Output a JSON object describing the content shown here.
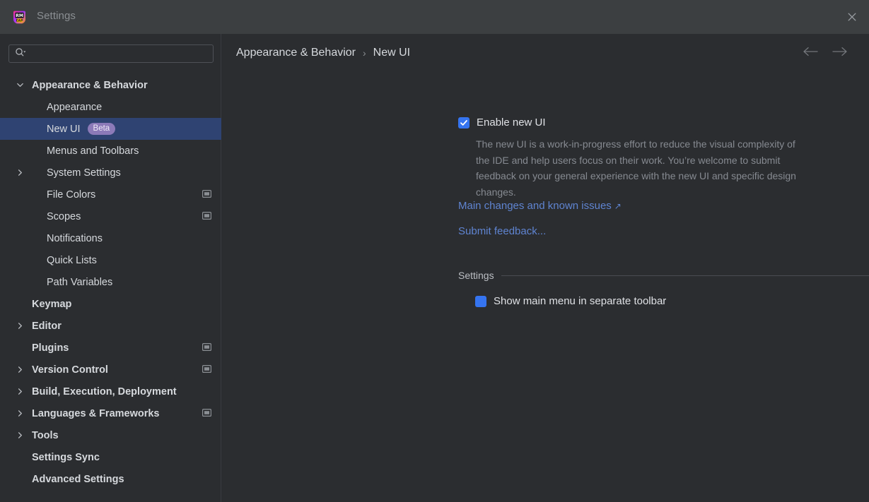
{
  "window": {
    "title": "Settings",
    "app_icon": "rubymine-eap-icon",
    "close_label": "×"
  },
  "sidebar": {
    "search": {
      "placeholder": "",
      "value": "",
      "icon": "search-icon"
    },
    "items": [
      {
        "label": "Appearance & Behavior",
        "level": 0,
        "expander": "chevron-down-icon",
        "selected": false,
        "scope_icon": false
      },
      {
        "label": "Appearance",
        "level": 1,
        "expander": "",
        "selected": false,
        "scope_icon": false
      },
      {
        "label": "New UI",
        "level": 1,
        "expander": "",
        "selected": true,
        "scope_icon": false,
        "badge": "Beta"
      },
      {
        "label": "Menus and Toolbars",
        "level": 1,
        "expander": "",
        "selected": false,
        "scope_icon": false
      },
      {
        "label": "System Settings",
        "level": 1,
        "expander": "chevron-right-icon",
        "selected": false,
        "scope_icon": false
      },
      {
        "label": "File Colors",
        "level": 1,
        "expander": "",
        "selected": false,
        "scope_icon": true
      },
      {
        "label": "Scopes",
        "level": 1,
        "expander": "",
        "selected": false,
        "scope_icon": true
      },
      {
        "label": "Notifications",
        "level": 1,
        "expander": "",
        "selected": false,
        "scope_icon": false
      },
      {
        "label": "Quick Lists",
        "level": 1,
        "expander": "",
        "selected": false,
        "scope_icon": false
      },
      {
        "label": "Path Variables",
        "level": 1,
        "expander": "",
        "selected": false,
        "scope_icon": false
      },
      {
        "label": "Keymap",
        "level": 0,
        "expander": "",
        "selected": false,
        "scope_icon": false
      },
      {
        "label": "Editor",
        "level": 0,
        "expander": "chevron-right-icon",
        "selected": false,
        "scope_icon": false
      },
      {
        "label": "Plugins",
        "level": 0,
        "expander": "",
        "selected": false,
        "scope_icon": true
      },
      {
        "label": "Version Control",
        "level": 0,
        "expander": "chevron-right-icon",
        "selected": false,
        "scope_icon": true
      },
      {
        "label": "Build, Execution, Deployment",
        "level": 0,
        "expander": "chevron-right-icon",
        "selected": false,
        "scope_icon": false
      },
      {
        "label": "Languages & Frameworks",
        "level": 0,
        "expander": "chevron-right-icon",
        "selected": false,
        "scope_icon": true
      },
      {
        "label": "Tools",
        "level": 0,
        "expander": "chevron-right-icon",
        "selected": false,
        "scope_icon": false
      },
      {
        "label": "Settings Sync",
        "level": 0,
        "expander": "",
        "selected": false,
        "scope_icon": false
      },
      {
        "label": "Advanced Settings",
        "level": 0,
        "expander": "",
        "selected": false,
        "scope_icon": false
      }
    ]
  },
  "main": {
    "breadcrumb": {
      "parent": "Appearance & Behavior",
      "separator": "›",
      "current": "New UI"
    },
    "nav": {
      "back_icon": "arrow-left-icon",
      "forward_icon": "arrow-right-icon"
    },
    "enable_new_ui": {
      "label": "Enable new UI",
      "checked": true,
      "description": "The new UI is a work-in-progress effort to reduce the visual complexity of the IDE and help users focus on their work. You’re welcome to submit feedback on your general experience with the new UI and specific design changes."
    },
    "links": [
      {
        "label": "Main changes and known issues",
        "external": true,
        "external_glyph": "↗"
      },
      {
        "label": "Submit feedback...",
        "external": false,
        "external_glyph": ""
      }
    ],
    "settings_group": {
      "title": "Settings",
      "options": [
        {
          "label": "Show main menu in separate toolbar",
          "checked": false
        }
      ]
    }
  },
  "colors": {
    "titlebar_bg": "#3c3f41",
    "body_bg": "#2b2d30",
    "selection_bg": "#2f4372",
    "accent": "#3574f0",
    "link": "#5f84d1",
    "badge_bg": "#8c7ab8",
    "text": "#d6d9dd",
    "muted_text": "#868a91"
  }
}
